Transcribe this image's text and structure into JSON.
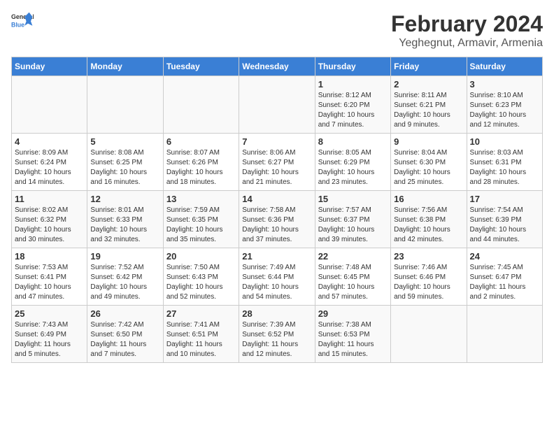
{
  "logo": {
    "line1": "General",
    "line2": "Blue"
  },
  "title": "February 2024",
  "subtitle": "Yeghegnut, Armavir, Armenia",
  "days_of_week": [
    "Sunday",
    "Monday",
    "Tuesday",
    "Wednesday",
    "Thursday",
    "Friday",
    "Saturday"
  ],
  "weeks": [
    [
      {
        "day": "",
        "info": ""
      },
      {
        "day": "",
        "info": ""
      },
      {
        "day": "",
        "info": ""
      },
      {
        "day": "",
        "info": ""
      },
      {
        "day": "1",
        "info": "Sunrise: 8:12 AM\nSunset: 6:20 PM\nDaylight: 10 hours\nand 7 minutes."
      },
      {
        "day": "2",
        "info": "Sunrise: 8:11 AM\nSunset: 6:21 PM\nDaylight: 10 hours\nand 9 minutes."
      },
      {
        "day": "3",
        "info": "Sunrise: 8:10 AM\nSunset: 6:23 PM\nDaylight: 10 hours\nand 12 minutes."
      }
    ],
    [
      {
        "day": "4",
        "info": "Sunrise: 8:09 AM\nSunset: 6:24 PM\nDaylight: 10 hours\nand 14 minutes."
      },
      {
        "day": "5",
        "info": "Sunrise: 8:08 AM\nSunset: 6:25 PM\nDaylight: 10 hours\nand 16 minutes."
      },
      {
        "day": "6",
        "info": "Sunrise: 8:07 AM\nSunset: 6:26 PM\nDaylight: 10 hours\nand 18 minutes."
      },
      {
        "day": "7",
        "info": "Sunrise: 8:06 AM\nSunset: 6:27 PM\nDaylight: 10 hours\nand 21 minutes."
      },
      {
        "day": "8",
        "info": "Sunrise: 8:05 AM\nSunset: 6:29 PM\nDaylight: 10 hours\nand 23 minutes."
      },
      {
        "day": "9",
        "info": "Sunrise: 8:04 AM\nSunset: 6:30 PM\nDaylight: 10 hours\nand 25 minutes."
      },
      {
        "day": "10",
        "info": "Sunrise: 8:03 AM\nSunset: 6:31 PM\nDaylight: 10 hours\nand 28 minutes."
      }
    ],
    [
      {
        "day": "11",
        "info": "Sunrise: 8:02 AM\nSunset: 6:32 PM\nDaylight: 10 hours\nand 30 minutes."
      },
      {
        "day": "12",
        "info": "Sunrise: 8:01 AM\nSunset: 6:33 PM\nDaylight: 10 hours\nand 32 minutes."
      },
      {
        "day": "13",
        "info": "Sunrise: 7:59 AM\nSunset: 6:35 PM\nDaylight: 10 hours\nand 35 minutes."
      },
      {
        "day": "14",
        "info": "Sunrise: 7:58 AM\nSunset: 6:36 PM\nDaylight: 10 hours\nand 37 minutes."
      },
      {
        "day": "15",
        "info": "Sunrise: 7:57 AM\nSunset: 6:37 PM\nDaylight: 10 hours\nand 39 minutes."
      },
      {
        "day": "16",
        "info": "Sunrise: 7:56 AM\nSunset: 6:38 PM\nDaylight: 10 hours\nand 42 minutes."
      },
      {
        "day": "17",
        "info": "Sunrise: 7:54 AM\nSunset: 6:39 PM\nDaylight: 10 hours\nand 44 minutes."
      }
    ],
    [
      {
        "day": "18",
        "info": "Sunrise: 7:53 AM\nSunset: 6:41 PM\nDaylight: 10 hours\nand 47 minutes."
      },
      {
        "day": "19",
        "info": "Sunrise: 7:52 AM\nSunset: 6:42 PM\nDaylight: 10 hours\nand 49 minutes."
      },
      {
        "day": "20",
        "info": "Sunrise: 7:50 AM\nSunset: 6:43 PM\nDaylight: 10 hours\nand 52 minutes."
      },
      {
        "day": "21",
        "info": "Sunrise: 7:49 AM\nSunset: 6:44 PM\nDaylight: 10 hours\nand 54 minutes."
      },
      {
        "day": "22",
        "info": "Sunrise: 7:48 AM\nSunset: 6:45 PM\nDaylight: 10 hours\nand 57 minutes."
      },
      {
        "day": "23",
        "info": "Sunrise: 7:46 AM\nSunset: 6:46 PM\nDaylight: 10 hours\nand 59 minutes."
      },
      {
        "day": "24",
        "info": "Sunrise: 7:45 AM\nSunset: 6:47 PM\nDaylight: 11 hours\nand 2 minutes."
      }
    ],
    [
      {
        "day": "25",
        "info": "Sunrise: 7:43 AM\nSunset: 6:49 PM\nDaylight: 11 hours\nand 5 minutes."
      },
      {
        "day": "26",
        "info": "Sunrise: 7:42 AM\nSunset: 6:50 PM\nDaylight: 11 hours\nand 7 minutes."
      },
      {
        "day": "27",
        "info": "Sunrise: 7:41 AM\nSunset: 6:51 PM\nDaylight: 11 hours\nand 10 minutes."
      },
      {
        "day": "28",
        "info": "Sunrise: 7:39 AM\nSunset: 6:52 PM\nDaylight: 11 hours\nand 12 minutes."
      },
      {
        "day": "29",
        "info": "Sunrise: 7:38 AM\nSunset: 6:53 PM\nDaylight: 11 hours\nand 15 minutes."
      },
      {
        "day": "",
        "info": ""
      },
      {
        "day": "",
        "info": ""
      }
    ]
  ]
}
